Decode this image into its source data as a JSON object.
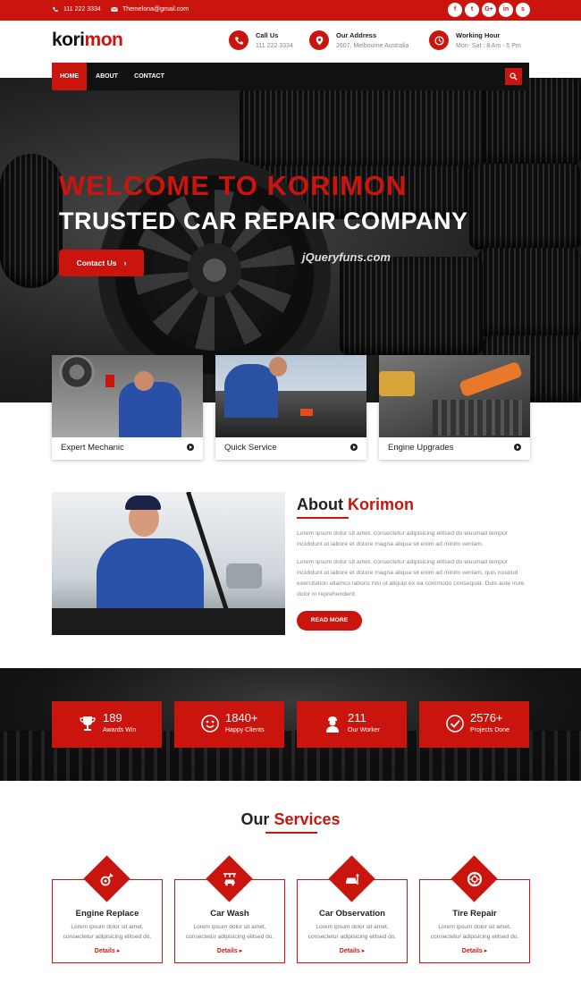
{
  "topbar": {
    "phone": "111 222 3334",
    "email": "Themelona@gmail.com",
    "social": [
      {
        "icon": "facebook-icon",
        "glyph": "f"
      },
      {
        "icon": "twitter-icon",
        "glyph": "t"
      },
      {
        "icon": "google-plus-icon",
        "glyph": "G+"
      },
      {
        "icon": "linkedin-icon",
        "glyph": "in"
      },
      {
        "icon": "skype-icon",
        "glyph": "s"
      }
    ]
  },
  "brand": {
    "logo_part1": "kori",
    "logo_part2": "mon"
  },
  "header_info": [
    {
      "icon": "phone-icon",
      "title": "Call Us",
      "sub": "111 222 3334"
    },
    {
      "icon": "location-icon",
      "title": "Our Address",
      "sub": "2607, Melbourne Australia"
    },
    {
      "icon": "clock-icon",
      "title": "Working Hour",
      "sub": "Mon- Sat : 8 Am - 5 Pm"
    }
  ],
  "nav": {
    "items": [
      {
        "label": "HOME",
        "active": true
      },
      {
        "label": "ABOUT",
        "active": false
      },
      {
        "label": "CONTACT",
        "active": false
      }
    ],
    "search_icon": "search-icon"
  },
  "hero": {
    "title1": "WELCOME TO KORIMON",
    "title2": "TRUSTED CAR REPAIR COMPANY",
    "button": "Contact Us",
    "watermark": "jQueryfuns.com"
  },
  "features": [
    {
      "label": "Expert Mechanic"
    },
    {
      "label": "Quick Service"
    },
    {
      "label": "Engine Upgrades"
    }
  ],
  "about": {
    "title1": "About",
    "title2": "Korimon",
    "p1": "Lorem ipsum dolor sit amet, consectetur adipisicing elitsed do eiusmad tempor incididunt ut labore et dolore magna aliqua sit enim ad minim veniam.",
    "p2": "Lorem ipsum dolor sit amet, consectetur adipisicing elitsed do eiusmad tempor incididunt ut labore et dolore magna aliqua sit enim ad minim veniam, quis nostrud exercitation ullamco laboris nisi ut aliquip ex ea commodo consequat. Duis aute irure dolor in reprehenderit.",
    "button": "READ MORE"
  },
  "counters": [
    {
      "icon": "trophy-icon",
      "number": "189",
      "label": "Awards Win"
    },
    {
      "icon": "smiley-icon",
      "number": "1840+",
      "label": "Happy Clients"
    },
    {
      "icon": "worker-icon",
      "number": "211",
      "label": "Our Worker"
    },
    {
      "icon": "check-circle-icon",
      "number": "2576+",
      "label": "Projects Done"
    }
  ],
  "services": {
    "title1": "Our",
    "title2": "Services",
    "items": [
      {
        "icon": "engine-icon",
        "title": "Engine Replace",
        "desc": "Lorem ipsum dolor sit amet, consectetur adipisicing elitsed do.",
        "link": "Details"
      },
      {
        "icon": "car-wash-icon",
        "title": "Car Wash",
        "desc": "Lorem ipsum dolor sit amet, consectetur adipisicing elitsed do.",
        "link": "Details"
      },
      {
        "icon": "car-observation-icon",
        "title": "Car Observation",
        "desc": "Lorem ipsum dolor sit amet, consectetur adipisicing elitsed do.",
        "link": "Details"
      },
      {
        "icon": "tire-icon",
        "title": "Tire Repair",
        "desc": "Lorem ipsum dolor sit amet, consectetur adipisicing elitsed do.",
        "link": "Details"
      }
    ]
  },
  "colors": {
    "accent": "#c9150e",
    "dark": "#111111"
  }
}
